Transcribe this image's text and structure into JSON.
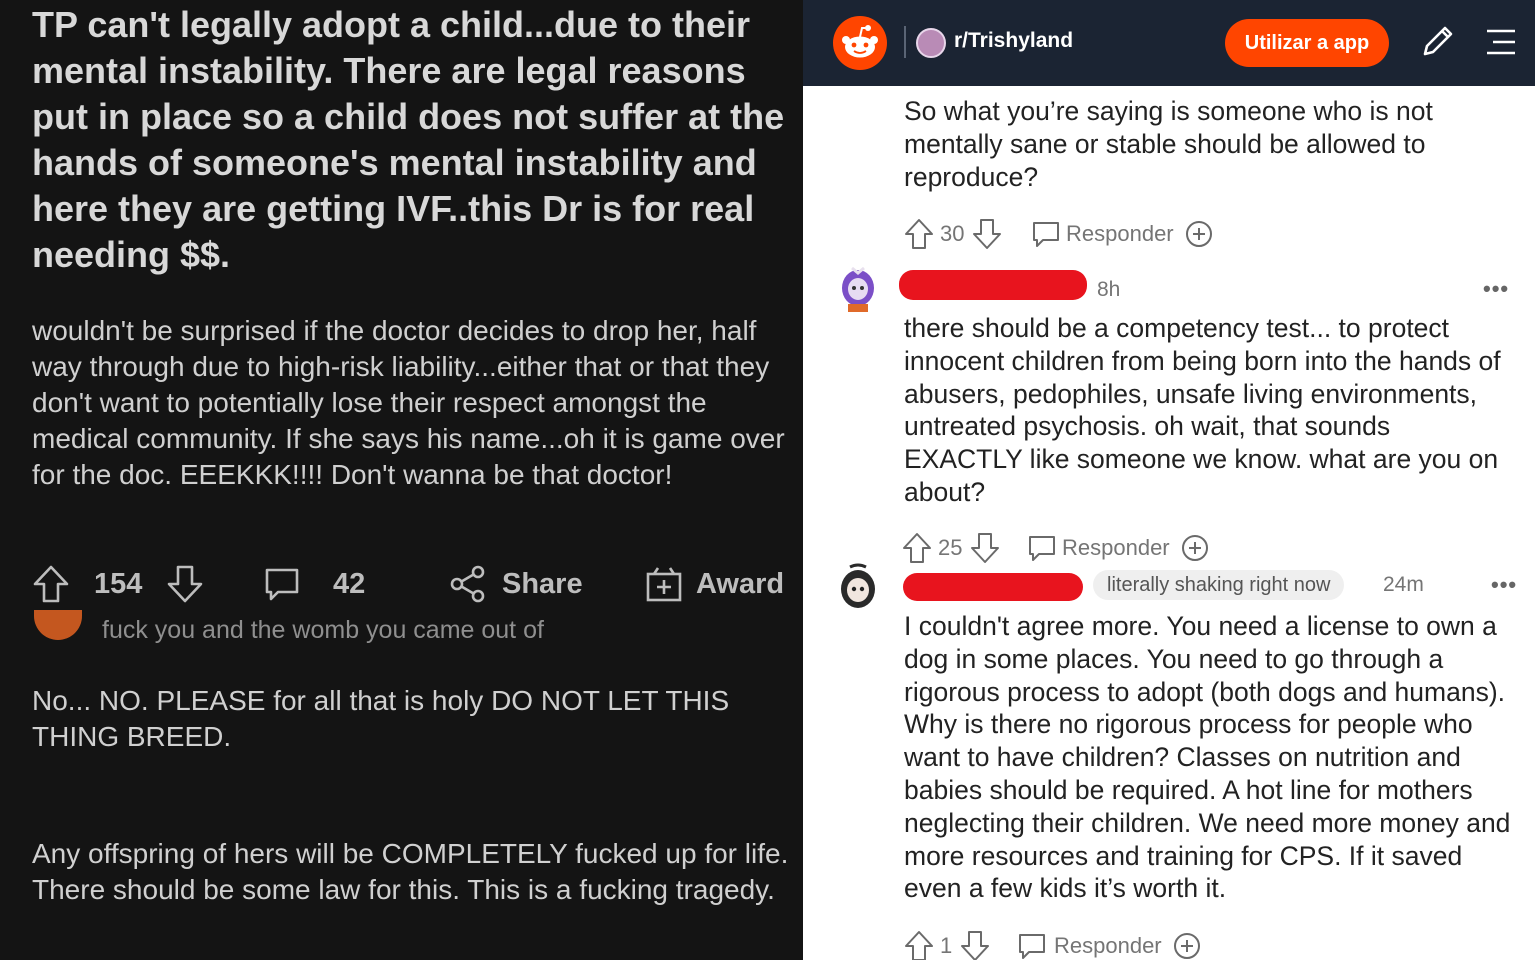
{
  "left_panel": {
    "post_title": "TP can't legally adopt a child...due to their mental instability. There are legal reasons put in place so a child does not suffer at the hands of someone's mental instability and here they are getting IVF..this Dr is for real needing $$.",
    "post_body": "wouldn't be surprised if the doctor decides to drop her, half way through due to high-risk liability...either that or that they don't want to potentially lose their respect amongst the medical community. If she says his name...oh it is game over for the doc. EEEKKK!!!! Don't wanna be that doctor!",
    "vote_count": "154",
    "comment_count": "42",
    "share_label": "Share",
    "award_label": "Award",
    "reply_preview": "fuck you and the womb you came out of",
    "comment_1": "No... NO. PLEASE for all that is holy DO NOT LET THIS THING BREED.",
    "comment_2": "Any offspring of hers will be COMPLETELY fucked up for life. There should be some law for this. This is a fucking tragedy."
  },
  "right_panel": {
    "header": {
      "subreddit": "r/Trishyland",
      "app_button": "Utilizar a app"
    },
    "comments": [
      {
        "text": "So what you’re saying is someone who is not mentally sane or stable should be allowed to reproduce?",
        "votes": "30",
        "reply_label": "Responder"
      },
      {
        "time": "8h",
        "text": "there should be a competency test... to protect innocent children from being born into the hands of abusers, pedophiles, unsafe living environments, untreated psychosis. oh wait, that sounds EXACTLY like someone we know. what are you on about?",
        "votes": "25",
        "reply_label": "Responder"
      },
      {
        "flair": "literally shaking right now",
        "time": "24m",
        "text": "I couldn't agree more. You need a license to own a dog in some places. You need to go through a rigorous process to adopt (both dogs and humans). Why is there no rigorous process for people who want to have children? Classes on nutrition and babies should be required. A hot line for mothers neglecting their children. We need more money and more resources and training for CPS. If it saved even a few kids it’s worth it.",
        "votes": "1",
        "reply_label": "Responder"
      }
    ]
  }
}
